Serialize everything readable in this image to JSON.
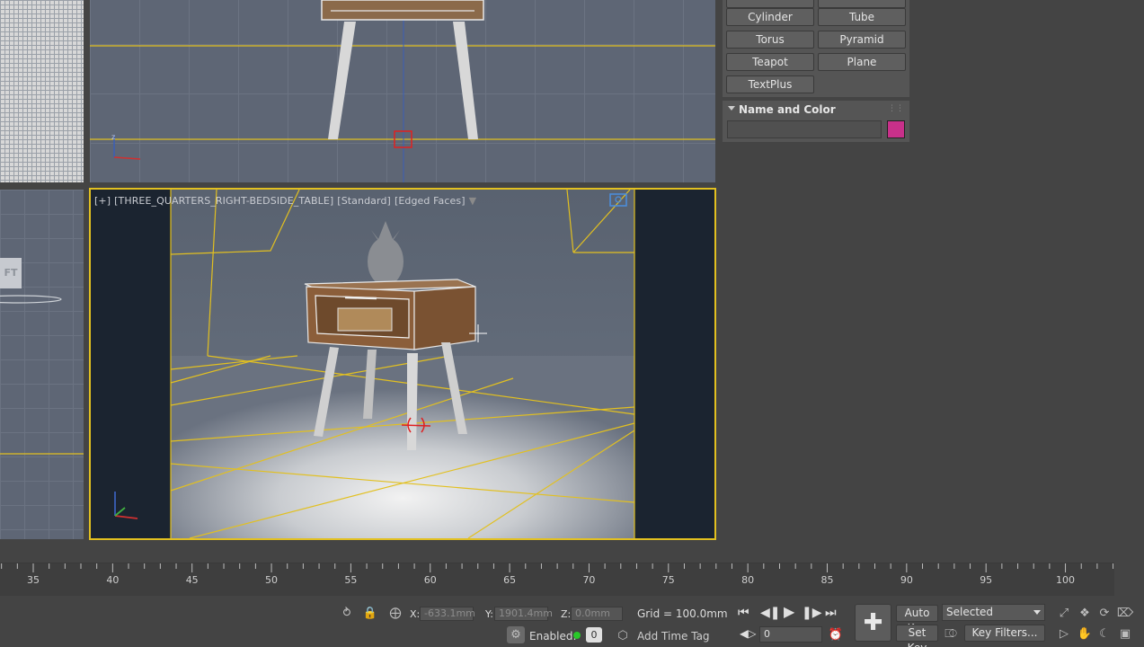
{
  "command_panel": {
    "primitives": [
      "Cylinder",
      "Tube",
      "Torus",
      "Pyramid",
      "Teapot",
      "Plane",
      "TextPlus"
    ],
    "name_and_color_title": "Name and Color",
    "object_name_value": "",
    "object_color": "#c8308a"
  },
  "viewports": {
    "perspective_label": {
      "plus": "[+]",
      "camera": "[THREE_QUARTERS_RIGHT-BEDSIDE_TABLE]",
      "shading_standard": "[Standard]",
      "shading_mode": "[Edged Faces]"
    },
    "left_bottom_tag": "FT",
    "active_border_color": "#e2c020"
  },
  "timeline": {
    "ticks": [
      "35",
      "40",
      "45",
      "50",
      "55",
      "60",
      "65",
      "70",
      "75",
      "80",
      "85",
      "90",
      "95",
      "100"
    ]
  },
  "status_bar": {
    "x_label": "X:",
    "x_value": "-633.1mm",
    "y_label": "Y:",
    "y_value": "1901.4mm",
    "z_label": "Z:",
    "z_value": "0.0mm",
    "grid_text": "Grid = 100.0mm",
    "enabled_label": "Enabled:",
    "enabled_count": "0",
    "add_time_tag": "Add Time Tag",
    "auto_key": "Auto Key",
    "set_key": "Set Key",
    "selected_option": "Selected",
    "key_filters": "Key Filters...",
    "current_frame": "0"
  }
}
